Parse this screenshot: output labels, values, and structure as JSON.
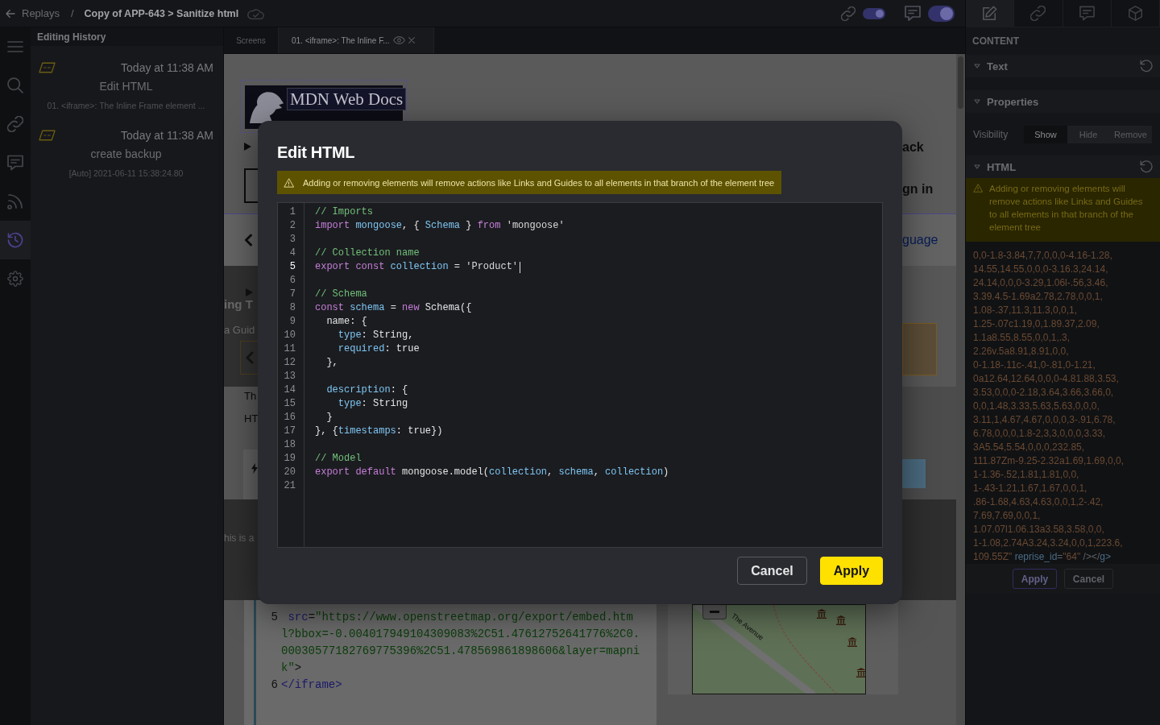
{
  "topbar": {
    "back_label": "Replays",
    "separator": "/",
    "title": "Copy of APP-643 > Sanitize html",
    "toggles": [
      {
        "kind": "link",
        "on": true
      },
      {
        "kind": "comment",
        "on": true
      }
    ]
  },
  "rail": {
    "items": [
      {
        "kind": "menu",
        "selected": false
      },
      {
        "kind": "search",
        "selected": false
      },
      {
        "kind": "link",
        "selected": false
      },
      {
        "kind": "comment",
        "selected": false
      },
      {
        "kind": "feed",
        "selected": false
      },
      {
        "kind": "history",
        "selected": true
      },
      {
        "kind": "settings",
        "selected": false
      }
    ]
  },
  "history": {
    "title": "Editing History",
    "entries": [
      {
        "time": "Today at 11:38 AM",
        "action": "Edit HTML",
        "detail": "01. <iframe>: The Inline Frame element ..."
      },
      {
        "time": "Today at 11:38 AM",
        "action": "create backup",
        "detail": "[Auto] 2021-06-11 15:38:24.80"
      }
    ]
  },
  "tabs": [
    {
      "label": "Screens",
      "selected": false
    },
    {
      "label": "01. <iframe>: The Inline F...",
      "selected": true
    }
  ],
  "preview": {
    "logo_text": "MDN Web Docs",
    "header_fragments": [
      "ack",
      "gn in"
    ],
    "nav_fragment": "guage",
    "heading_fragment": "ing T",
    "subheading_fragment": "a Guid",
    "paragraph_fragments": [
      "Th",
      "HT"
    ],
    "notice_fragment": "his is a",
    "code_lines": [
      {
        "number": "5",
        "tokens": [
          {
            "kind": "attr",
            "text": " src"
          },
          {
            "kind": "punct",
            "text": "="
          },
          {
            "kind": "string",
            "text": "\"https://www.openstreetmap.org/export/embed.html?bbox=-0.004017949104309083%2C51.47612752641776%2C0.00030577182769775396%2C51.478569861898606&layer=mapnik\""
          },
          {
            "kind": "punct",
            "text": ">"
          }
        ]
      },
      {
        "number": "6",
        "tokens": [
          {
            "kind": "tag",
            "text": "</iframe>"
          }
        ]
      }
    ],
    "map": {
      "street_label": "The Avenue"
    }
  },
  "inspector": {
    "tabs": [
      {
        "kind": "edit",
        "selected": true
      },
      {
        "kind": "link",
        "selected": false
      },
      {
        "kind": "comment",
        "selected": false
      },
      {
        "kind": "cube",
        "selected": false
      }
    ],
    "heading": "CONTENT",
    "text_section": {
      "title": "Text",
      "expanded": true
    },
    "properties_section": {
      "title": "Properties",
      "expanded": true,
      "visibility_label": "Visibility",
      "visibility_options": [
        {
          "label": "Show",
          "selected": true
        },
        {
          "label": "Hide",
          "selected": false
        },
        {
          "label": "Remove",
          "selected": false
        }
      ]
    },
    "html_section": {
      "title": "HTML",
      "expanded": true,
      "warning": "Adding or removing elements will remove actions like Links and Guides to all elements in that branch of the element tree",
      "code_lines": [
        {
          "tokens": [
            {
              "kind": "value",
              "text": "0,0-1.8-3.84,7,7,0,0,0-4.16-1.28,"
            }
          ]
        },
        {
          "tokens": [
            {
              "kind": "value",
              "text": "14.55,14.55,0,0,0-3.16.3,24.14,"
            }
          ]
        },
        {
          "tokens": [
            {
              "kind": "value",
              "text": "24.14,0,0,0-3.29,1.06l-.56,3.46,"
            }
          ]
        },
        {
          "tokens": [
            {
              "kind": "value",
              "text": "3.39.4.5-1.69a2.78,2.78,0,0,1,"
            }
          ]
        },
        {
          "tokens": [
            {
              "kind": "value",
              "text": "1.08-.37,11.3,11.3,0,0,1,"
            }
          ]
        },
        {
          "tokens": [
            {
              "kind": "value",
              "text": "1.25-.07c1.19,0,1.89.37,2.09,"
            }
          ]
        },
        {
          "tokens": [
            {
              "kind": "value",
              "text": "1.1a8.55,8.55,0,0,1,.3,"
            }
          ]
        },
        {
          "tokens": [
            {
              "kind": "value",
              "text": "2.26v.5a8.91,8.91,0,0,"
            }
          ]
        },
        {
          "tokens": [
            {
              "kind": "value",
              "text": "0-1.18-.11c-.41,0-.81,0-1.21,"
            }
          ]
        },
        {
          "tokens": [
            {
              "kind": "value",
              "text": "0a12.64,12.64,0,0,0-4.81.88,3.53,"
            }
          ]
        },
        {
          "tokens": [
            {
              "kind": "value",
              "text": "3.53,0,0,0-2.18,3.64,3.66,3.66,0,"
            }
          ]
        },
        {
          "tokens": [
            {
              "kind": "value",
              "text": "0,0,1.48,3.33,5.63,5.63,0,0,0,"
            }
          ]
        },
        {
          "tokens": [
            {
              "kind": "value",
              "text": "3.11,1,4.67,4.67,0,0,0,3-.91,6.78,"
            }
          ]
        },
        {
          "tokens": [
            {
              "kind": "value",
              "text": "6.78,0,0,0,1.8-2,3,3,0,0,0,3.33,"
            }
          ]
        },
        {
          "tokens": [
            {
              "kind": "value",
              "text": "3A5.54,5.54,0,0,0,232.85,"
            }
          ]
        },
        {
          "tokens": [
            {
              "kind": "value",
              "text": "111.87Zm-9.25-2.32a1.69,1.69,0,0,"
            }
          ]
        },
        {
          "tokens": [
            {
              "kind": "value",
              "text": "1-1.36-.52,1.81,1.81,0,0,"
            }
          ]
        },
        {
          "tokens": [
            {
              "kind": "value",
              "text": "1-.43-1.21,1.67,1.67,0,0,1,"
            }
          ]
        },
        {
          "tokens": [
            {
              "kind": "value",
              "text": ".86-1.68,4.63,4.63,0,0,1,2-.42,"
            }
          ]
        },
        {
          "tokens": [
            {
              "kind": "value",
              "text": "7.69,7.69,0,0,1,"
            }
          ]
        },
        {
          "tokens": [
            {
              "kind": "value",
              "text": "1.07.07l1.06.13a3.58,3.58,0,0,"
            }
          ]
        },
        {
          "tokens": [
            {
              "kind": "value",
              "text": "1-1.08,2.74A3.24,3.24,0,0,1,223.6,"
            }
          ]
        },
        {
          "tokens": [
            {
              "kind": "value",
              "text": "109.55Z\""
            },
            {
              "kind": "attr",
              "text": " reprise_id"
            },
            {
              "kind": "punct",
              "text": "="
            },
            {
              "kind": "value",
              "text": "\"64\""
            },
            {
              "kind": "punct",
              "text": " /></"
            },
            {
              "kind": "tag",
              "text": "g>"
            }
          ]
        }
      ],
      "buttons": [
        {
          "label": "Apply",
          "kind": "primary"
        },
        {
          "label": "Cancel",
          "kind": "secondary"
        }
      ]
    }
  },
  "dialog": {
    "title": "Edit HTML",
    "warning": "Adding or removing elements will remove actions like Links and Guides to all elements in that branch of the element tree",
    "code": [
      {
        "number": "1",
        "current": false,
        "tokens": [
          {
            "kind": "comment",
            "text": "// Imports"
          }
        ]
      },
      {
        "number": "2",
        "current": false,
        "tokens": [
          {
            "kind": "keyword",
            "text": "import"
          },
          {
            "kind": "name",
            "text": " mongoose"
          },
          {
            "kind": "plain",
            "text": ", { "
          },
          {
            "kind": "name",
            "text": "Schema"
          },
          {
            "kind": "plain",
            "text": " } "
          },
          {
            "kind": "keyword",
            "text": "from"
          },
          {
            "kind": "string",
            "text": " 'mongoose'"
          }
        ]
      },
      {
        "number": "3",
        "current": false
      },
      {
        "number": "4",
        "current": false,
        "tokens": [
          {
            "kind": "comment",
            "text": "// Collection name"
          }
        ]
      },
      {
        "number": "5",
        "current": true,
        "tokens": [
          {
            "kind": "keyword",
            "text": "export const"
          },
          {
            "kind": "name",
            "text": " collection"
          },
          {
            "kind": "plain",
            "text": " = "
          },
          {
            "kind": "string",
            "text": "'Product'"
          }
        ]
      },
      {
        "number": "6",
        "current": false
      },
      {
        "number": "7",
        "current": false,
        "tokens": [
          {
            "kind": "comment",
            "text": "// Schema"
          }
        ]
      },
      {
        "number": "8",
        "current": false,
        "tokens": [
          {
            "kind": "keyword",
            "text": "const"
          },
          {
            "kind": "name",
            "text": " schema"
          },
          {
            "kind": "plain",
            "text": " = "
          },
          {
            "kind": "keyword",
            "text": "new"
          },
          {
            "kind": "plain",
            "text": " Schema({"
          }
        ]
      },
      {
        "number": "9",
        "current": false,
        "tokens": [
          {
            "kind": "plain",
            "text": "  name: {"
          }
        ]
      },
      {
        "number": "10",
        "current": false,
        "tokens": [
          {
            "kind": "name",
            "text": "    type"
          },
          {
            "kind": "plain",
            "text": ": String,"
          }
        ]
      },
      {
        "number": "11",
        "current": false,
        "tokens": [
          {
            "kind": "name",
            "text": "    required"
          },
          {
            "kind": "plain",
            "text": ": true"
          }
        ]
      },
      {
        "number": "12",
        "current": false,
        "tokens": [
          {
            "kind": "plain",
            "text": "  },"
          }
        ]
      },
      {
        "number": "13",
        "current": false
      },
      {
        "number": "14",
        "current": false,
        "tokens": [
          {
            "kind": "name",
            "text": "  description"
          },
          {
            "kind": "plain",
            "text": ": {"
          }
        ]
      },
      {
        "number": "15",
        "current": false,
        "tokens": [
          {
            "kind": "name",
            "text": "    type"
          },
          {
            "kind": "plain",
            "text": ": String"
          }
        ]
      },
      {
        "number": "16",
        "current": false,
        "tokens": [
          {
            "kind": "plain",
            "text": "  }"
          }
        ]
      },
      {
        "number": "17",
        "current": false,
        "tokens": [
          {
            "kind": "plain",
            "text": "}, {"
          },
          {
            "kind": "name",
            "text": "timestamps"
          },
          {
            "kind": "plain",
            "text": ": true})"
          }
        ]
      },
      {
        "number": "18",
        "current": false
      },
      {
        "number": "19",
        "current": false,
        "tokens": [
          {
            "kind": "comment",
            "text": "// Model"
          }
        ]
      },
      {
        "number": "20",
        "current": false,
        "tokens": [
          {
            "kind": "keyword",
            "text": "export default"
          },
          {
            "kind": "plain",
            "text": " mongoose.model("
          },
          {
            "kind": "name",
            "text": "collection"
          },
          {
            "kind": "plain",
            "text": ", "
          },
          {
            "kind": "name",
            "text": "schema"
          },
          {
            "kind": "plain",
            "text": ", "
          },
          {
            "kind": "name",
            "text": "collection"
          },
          {
            "kind": "plain",
            "text": ")"
          }
        ]
      },
      {
        "number": "21",
        "current": false
      }
    ],
    "buttons": [
      {
        "label": "Cancel",
        "kind": "secondary"
      },
      {
        "label": "Apply",
        "kind": "primary"
      }
    ]
  }
}
